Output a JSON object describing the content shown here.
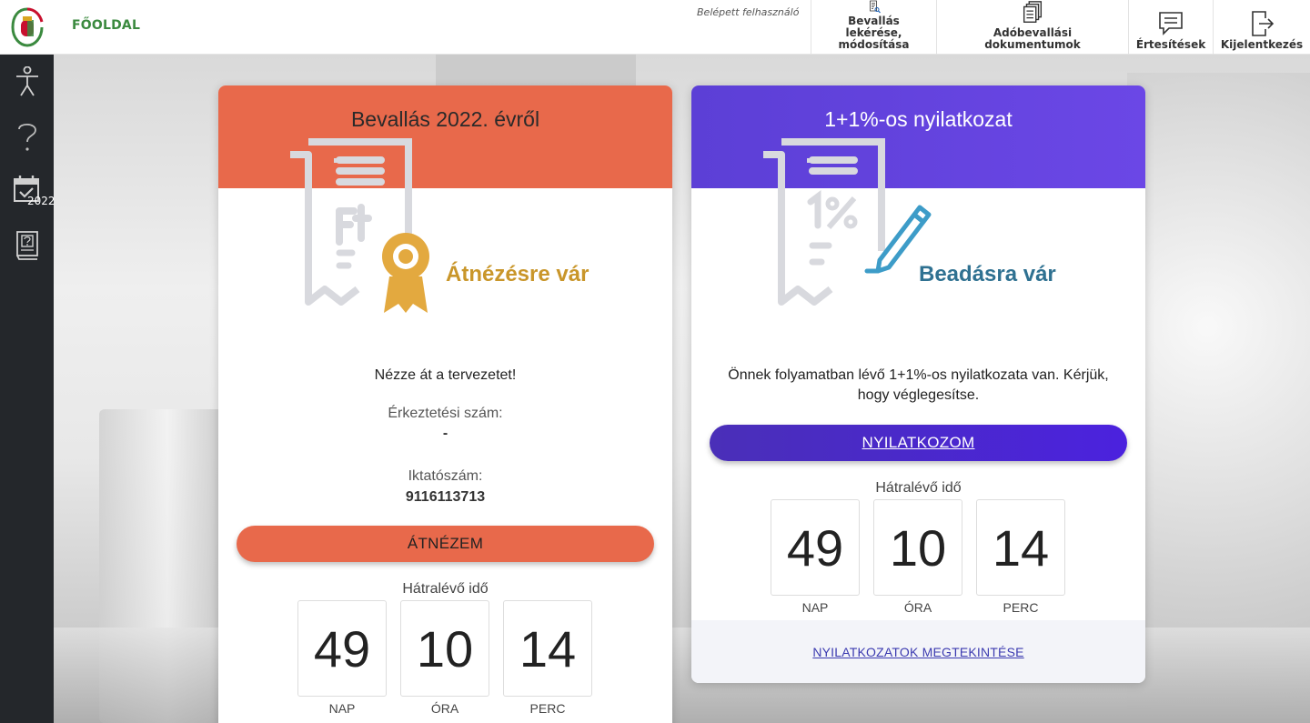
{
  "header": {
    "home_label": "FŐOLDAL",
    "logged_user_label": "Belépett felhasználó",
    "nav": [
      {
        "label": "Bevallás lekérése,",
        "label2": "módosítása",
        "icon": "document-search-icon"
      },
      {
        "label": "Adóbevallási dokumentumok",
        "icon": "documents-stack-icon"
      },
      {
        "label": "Értesítések",
        "icon": "message-icon"
      },
      {
        "label": "Kijelentkezés",
        "icon": "logout-icon"
      }
    ]
  },
  "sidebar": {
    "items": [
      {
        "icon": "accessibility-icon"
      },
      {
        "icon": "help-icon"
      },
      {
        "icon": "calendar-check-icon",
        "badge": "2022"
      },
      {
        "icon": "help-book-icon"
      }
    ]
  },
  "colors": {
    "accent_orange": "#e8694b",
    "accent_purple": "#5c3fd6",
    "status_gold": "#c9962a",
    "status_teal": "#2f7191",
    "sidebar": "#24272b",
    "home_green": "#3b8a3f"
  },
  "cards": {
    "left": {
      "title": "Bevallás 2022. évről",
      "status": "Átnézésre vár",
      "message": "Nézze át a tervezetet!",
      "arrival_label": "Érkeztetési szám:",
      "arrival_value": "-",
      "reg_label": "Iktatószám:",
      "reg_value": "9116113713",
      "button_label": "ÁTNÉZEM",
      "timer_label": "Hátralévő idő",
      "timer": {
        "days": "49",
        "days_unit": "NAP",
        "hours": "10",
        "hours_unit": "ÓRA",
        "minutes": "14",
        "minutes_unit": "PERC"
      }
    },
    "right": {
      "title": "1+1%-os nyilatkozat",
      "status": "Beadásra vár",
      "message_line1": "Önnek folyamatban lévő 1+1%-os nyilatkozata van. Kérjük,",
      "message_line2": "hogy véglegesítse.",
      "button_label": "NYILATKOZOM",
      "timer_label": "Hátralévő idő",
      "timer": {
        "days": "49",
        "days_unit": "NAP",
        "hours": "10",
        "hours_unit": "ÓRA",
        "minutes": "14",
        "minutes_unit": "PERC"
      },
      "footer_link": "NYILATKOZATOK MEGTEKINTÉSE"
    }
  }
}
